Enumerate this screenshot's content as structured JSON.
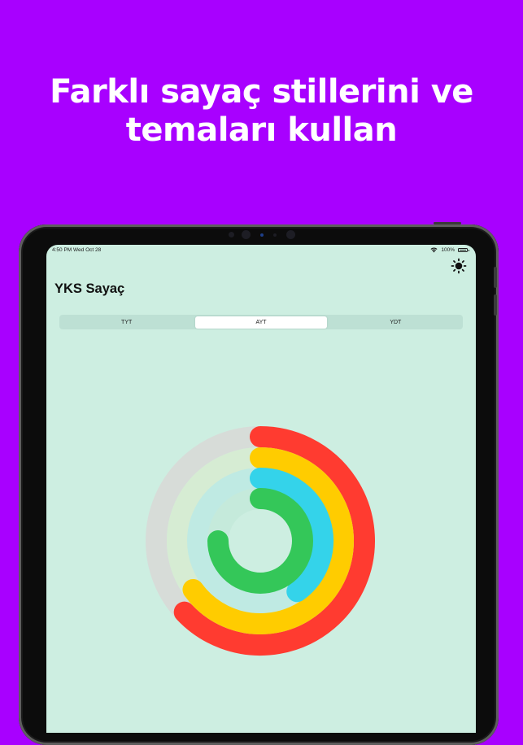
{
  "headline": {
    "line1": "Farklı sayaç stillerini ve",
    "line2": "temaları kullan"
  },
  "status_bar": {
    "time_date": "4:50 PM   Wed Oct 28",
    "battery": "100%"
  },
  "app": {
    "title": "YKS Sayaç",
    "theme_icon": "sun-icon",
    "tabs": [
      "TYT",
      "AYT",
      "YDT"
    ],
    "selected_tab": "AYT"
  },
  "rings": [
    {
      "name": "outer",
      "color": "#ff3b30",
      "track_color": "#d7dcd8",
      "progress": 0.63
    },
    {
      "name": "second",
      "color": "#ffcc00",
      "track_color": "#d6ecd3",
      "progress": 0.65
    },
    {
      "name": "third",
      "color": "#34d3ea",
      "track_color": "#bfeae3",
      "progress": 0.4
    },
    {
      "name": "inner",
      "color": "#34c759",
      "track_color": "#c5eadb",
      "progress": 0.75
    }
  ]
}
